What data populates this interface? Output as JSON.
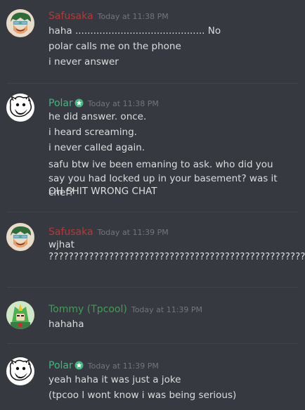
{
  "colors": {
    "background": "#36393f",
    "safusaka_name": "#b33a3a",
    "polar_name": "#43b581",
    "tommy_name": "#3e9e54",
    "timestamp": "#72767d",
    "text": "#dcddde"
  },
  "messages": [
    {
      "author": "Safusaka",
      "timestamp": "Today at 11:38 PM",
      "avatar": "safusaka-avatar",
      "lines": [
        "haha ........................................... No",
        "polar calls me on the phone",
        "i never answer"
      ]
    },
    {
      "author": "Polar",
      "badge": "star-badge-icon",
      "timestamp": "Today at 11:38 PM",
      "avatar": "polar-avatar",
      "lines": [
        "he did answer. once.",
        "i heard screaming.",
        "i never called again.",
        "safu btw ive been emaning to ask. who did you say you had locked up in your basement? was it chef?",
        "OH SHIT WRONG CHAT"
      ]
    },
    {
      "author": "Safusaka",
      "timestamp": "Today at 11:39 PM",
      "avatar": "safusaka-avatar",
      "lines": [
        "wjhat ????????????????????????????????????????????????????"
      ]
    },
    {
      "author": "Tommy (Tpcool)",
      "timestamp": "Today at 11:39 PM",
      "avatar": "tommy-avatar",
      "lines": [
        "hahaha"
      ]
    },
    {
      "author": "Polar",
      "badge": "star-badge-icon",
      "timestamp": "Today at 11:39 PM",
      "avatar": "polar-avatar",
      "lines": [
        "yeah haha it was just a joke",
        "(tpcoo l wont know i was being serious)"
      ]
    }
  ]
}
